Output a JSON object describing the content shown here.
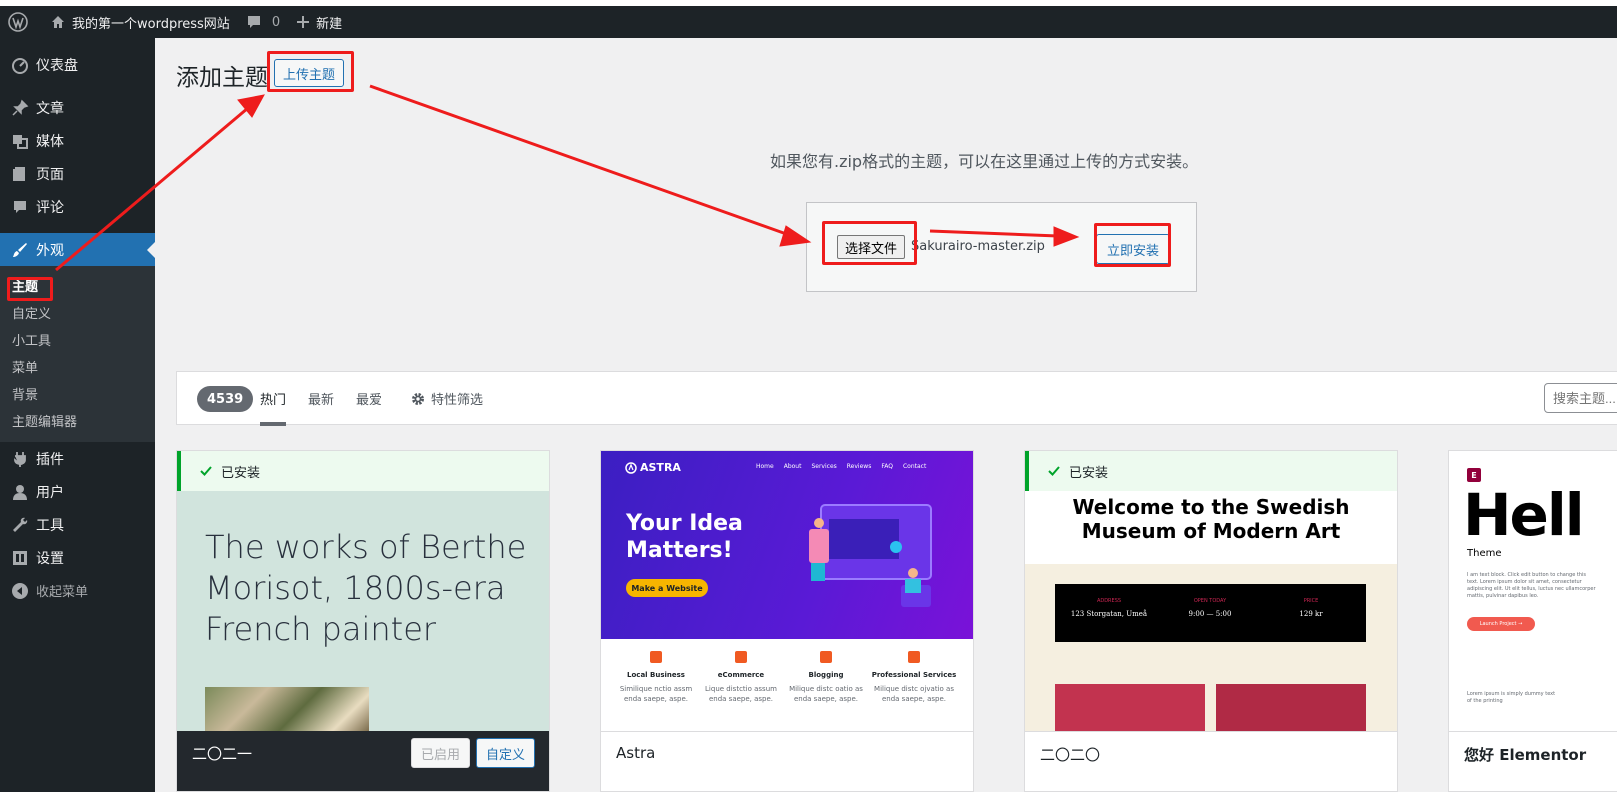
{
  "adminbar": {
    "site_name": "我的第一个wordpress网站",
    "comments_count": "0",
    "new_label": "新建"
  },
  "sidebar": {
    "items": [
      {
        "label": "仪表盘",
        "icon": "dashboard-icon"
      },
      {
        "label": "文章",
        "icon": "pin-icon"
      },
      {
        "label": "媒体",
        "icon": "media-icon"
      },
      {
        "label": "页面",
        "icon": "page-icon"
      },
      {
        "label": "评论",
        "icon": "comment-icon"
      },
      {
        "label": "外观",
        "icon": "brush-icon"
      },
      {
        "label": "插件",
        "icon": "plugin-icon"
      },
      {
        "label": "用户",
        "icon": "user-icon"
      },
      {
        "label": "工具",
        "icon": "wrench-icon"
      },
      {
        "label": "设置",
        "icon": "settings-icon"
      },
      {
        "label": "收起菜单",
        "icon": "collapse-icon"
      }
    ],
    "submenu": [
      "主题",
      "自定义",
      "小工具",
      "菜单",
      "背景",
      "主题编辑器"
    ]
  },
  "main": {
    "title": "添加主题",
    "upload_button": "上传主题",
    "upload_hint": "如果您有.zip格式的主题，可以在这里通过上传的方式安装。",
    "choose_file": "选择文件",
    "file_name": "Sakurairo-master.zip",
    "install_now": "立即安装"
  },
  "filters": {
    "count": "4539",
    "tabs": [
      "热门",
      "最新",
      "最爱"
    ],
    "feature_filter": "特性筛选",
    "search_placeholder": "搜索主题..."
  },
  "themes": [
    {
      "name": "二〇二一",
      "installed_label": "已安装",
      "headline": "The works of Berthe Morisot, 1800s-era French painter",
      "activated_label": "已启用",
      "customize_label": "自定义"
    },
    {
      "name": "Astra",
      "logo": "ASTRA",
      "nav": [
        "Home",
        "About",
        "Services",
        "Reviews",
        "FAQ",
        "Contact"
      ],
      "hero_title": "Your Idea Matters!",
      "cta": "Make a Website",
      "services": [
        {
          "title": "Local Business",
          "desc": "Similique nctio assm enda saepe, aspe."
        },
        {
          "title": "eCommerce",
          "desc": "Lique distctio assum enda saepe, aspe."
        },
        {
          "title": "Blogging",
          "desc": "Milique distc oatio as enda saepe, aspe."
        },
        {
          "title": "Professional Services",
          "desc": "Milique distc ojvatio as enda saepe, aspe."
        }
      ]
    },
    {
      "name": "二〇二〇",
      "installed_label": "已安装",
      "museum_title": "Welcome to the Swedish Museum of Modern Art",
      "info": [
        {
          "label": "ADDRESS",
          "value": "123 Storgatan, Umeå"
        },
        {
          "label": "OPEN TODAY",
          "value": "9:00 — 5:00"
        },
        {
          "label": "PRICE",
          "value": "129 kr"
        }
      ]
    },
    {
      "name": "您好 Elementor",
      "big_text": "Hell",
      "subtitle": "Theme",
      "body_text": "I am text block. Click edit button to change this text. Lorem ipsum dolor sit amet, consectetur adipiscing elit. Ut elit tellus, luctus nec ullamcorper mattis, pulvinar dapibus leo.",
      "button": "Launch Project →",
      "lower_text": "Lorem ipsum is simply dummy text of the printing"
    }
  ],
  "colors": {
    "admin_dark": "#1d2327",
    "accent_blue": "#2271b1",
    "annotation_red": "#ee1c1c",
    "installed_green": "#00a32a"
  }
}
